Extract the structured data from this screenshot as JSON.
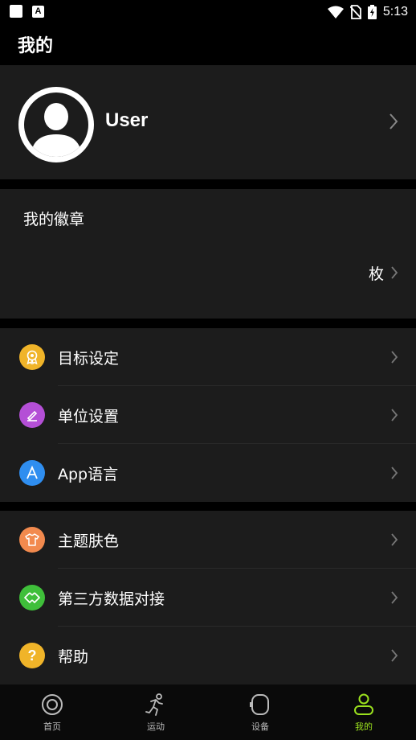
{
  "status_bar": {
    "time": "5:13"
  },
  "header": {
    "title": "我的"
  },
  "profile": {
    "name": "User"
  },
  "badges": {
    "title": "我的徽章",
    "count_unit": "枚"
  },
  "menu_group_1": [
    {
      "label": "目标设定",
      "icon": "award-icon",
      "color": "#f0b429"
    },
    {
      "label": "单位设置",
      "icon": "ruler-icon",
      "color": "#b44fd6"
    },
    {
      "label": "App语言",
      "icon": "language-icon",
      "color": "#2f8ef0"
    }
  ],
  "menu_group_2": [
    {
      "label": "主题肤色",
      "icon": "tshirt-icon",
      "color": "#f28a4e"
    },
    {
      "label": "第三方数据对接",
      "icon": "link-icon",
      "color": "#3fbf3a"
    },
    {
      "label": "帮助",
      "icon": "help-icon",
      "color": "#f0b429"
    }
  ],
  "tabs": [
    {
      "label": "首页",
      "icon": "home-icon"
    },
    {
      "label": "运动",
      "icon": "run-icon"
    },
    {
      "label": "设备",
      "icon": "watch-icon"
    },
    {
      "label": "我的",
      "icon": "profile-icon",
      "active": true
    }
  ],
  "colors": {
    "accent": "#9be11e",
    "card": "#1c1c1c",
    "background": "#000000"
  }
}
